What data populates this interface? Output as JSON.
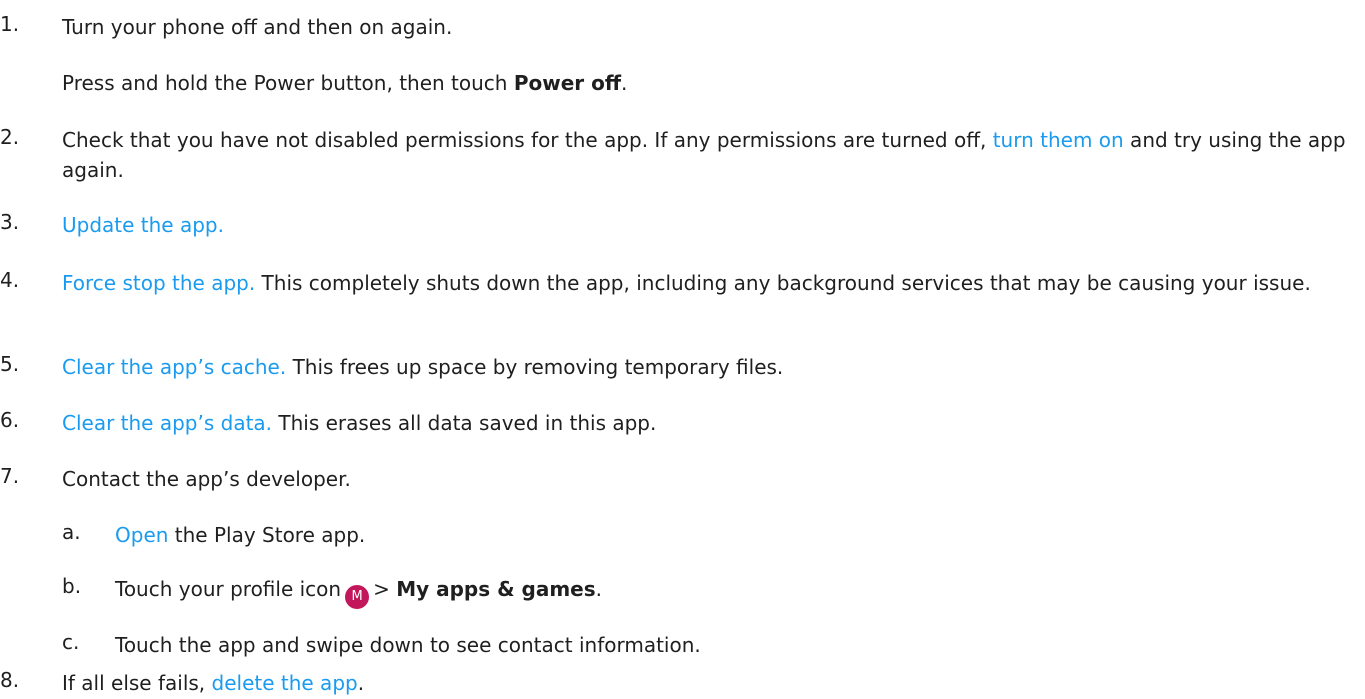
{
  "steps": {
    "s1": {
      "num": "1.",
      "text": "Turn your phone off and then on again.",
      "detail_pre": "Press and hold the Power button, then touch ",
      "detail_bold": "Power off",
      "detail_post": "."
    },
    "s2": {
      "num": "2.",
      "pre": "Check that you have not disabled permissions for the app. If any permissions are turned off, ",
      "link": "turn them on",
      "post": " and try using the app again."
    },
    "s3": {
      "num": "3.",
      "link": "Update the app."
    },
    "s4": {
      "num": "4.",
      "link": "Force stop the app.",
      "post": " This completely shuts down the app, including any background services that may be causing your issue."
    },
    "s5": {
      "num": "5.",
      "link": "Clear the app’s cache.",
      "post": " This frees up space by removing temporary files."
    },
    "s6": {
      "num": "6.",
      "link": "Clear the app’s data.",
      "post": " This erases all data saved in this app."
    },
    "s7": {
      "num": "7.",
      "text": "Contact the app’s developer.",
      "sub": {
        "a": {
          "letter": "a.",
          "link": "Open",
          "post": " the Play Store app."
        },
        "b": {
          "letter": "b.",
          "pre": "Touch your profile icon",
          "avatar": "M",
          "sep": "> ",
          "bold": "My apps & games",
          "post": "."
        },
        "c": {
          "letter": "c.",
          "text": "Touch the app and swipe down to see contact information."
        }
      }
    },
    "s8": {
      "num": "8.",
      "pre": "If all else fails, ",
      "link": "delete the app",
      "post": "."
    }
  },
  "colors": {
    "link": "#1a9bef",
    "text": "#1f1f1f",
    "avatar_bg": "#c2185b"
  },
  "icons": {
    "profile": "profile-avatar-icon"
  }
}
